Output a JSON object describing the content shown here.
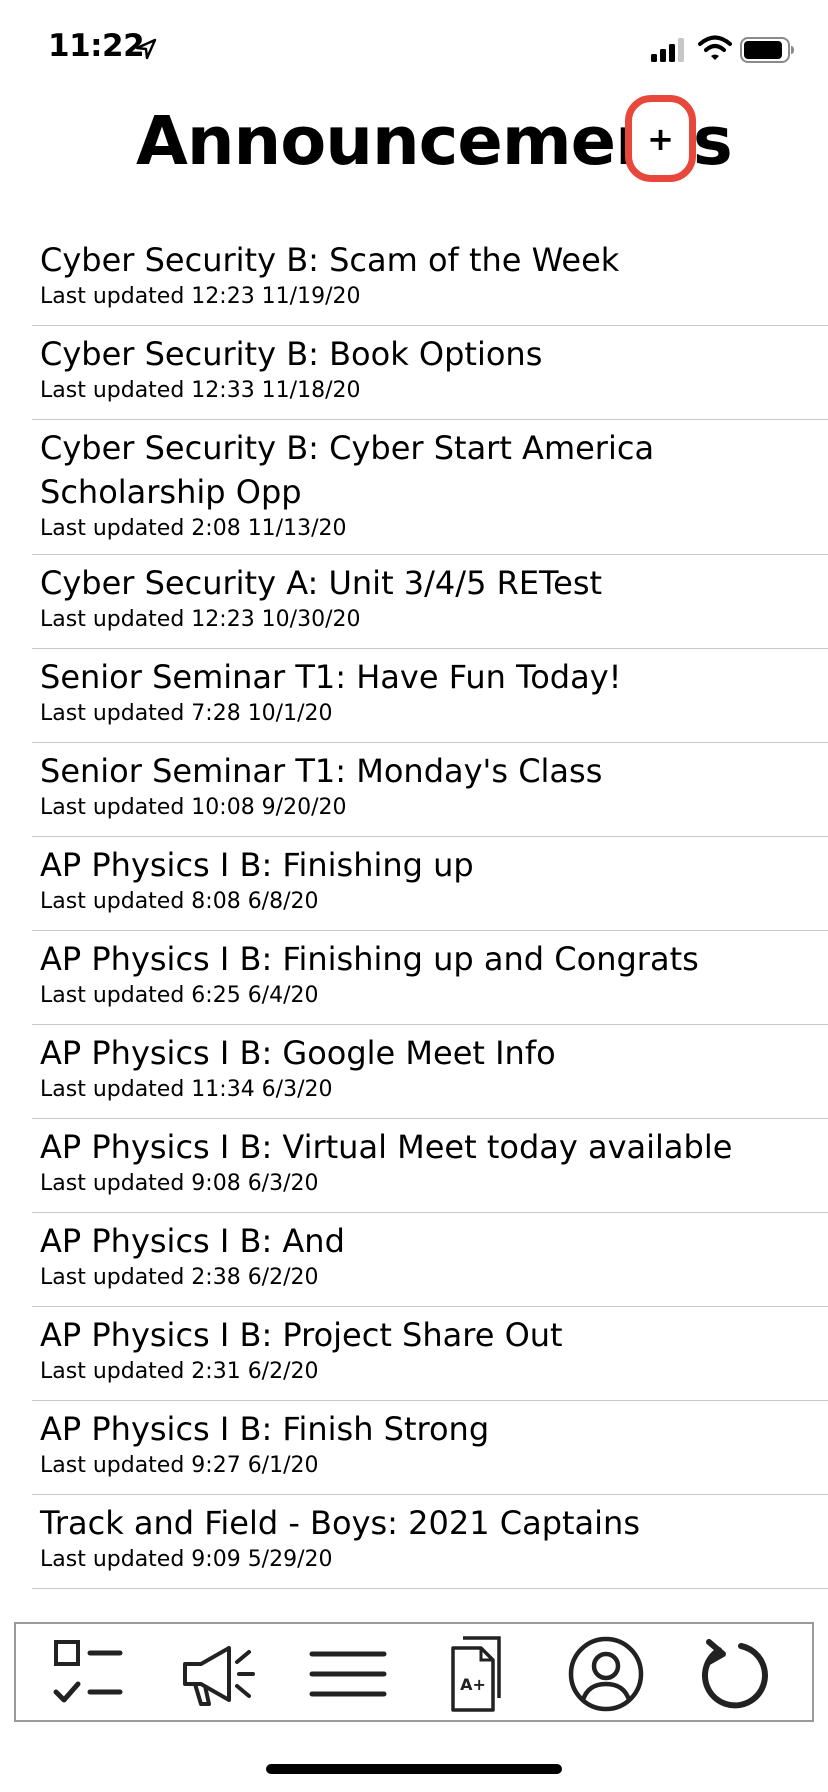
{
  "status_bar": {
    "time": "11:22",
    "icons": [
      "location-arrow-icon",
      "cellular-signal-icon",
      "wifi-icon",
      "battery-icon"
    ]
  },
  "header": {
    "title": "Announcements",
    "add_label": "+",
    "accent_color": "#e8473b"
  },
  "announcements": [
    {
      "title": "Cyber Security B: Scam of the Week",
      "updated": "Last updated 12:23 11/19/20"
    },
    {
      "title": "Cyber Security B: Book Options",
      "updated": "Last updated 12:33 11/18/20"
    },
    {
      "title": "Cyber Security B: Cyber Start America Scholarship Opp",
      "updated": "Last updated 2:08 11/13/20"
    },
    {
      "title": "Cyber Security A: Unit 3/4/5 RETest",
      "updated": "Last updated 12:23 10/30/20"
    },
    {
      "title": "Senior Seminar T1: Have Fun Today!",
      "updated": "Last updated 7:28 10/1/20"
    },
    {
      "title": "Senior Seminar T1: Monday's Class",
      "updated": "Last updated 10:08 9/20/20"
    },
    {
      "title": "AP Physics I B: Finishing up",
      "updated": "Last updated 8:08 6/8/20"
    },
    {
      "title": "AP Physics I B: Finishing up and Congrats",
      "updated": "Last updated 6:25 6/4/20"
    },
    {
      "title": "AP Physics I B: Google Meet Info",
      "updated": "Last updated 11:34 6/3/20"
    },
    {
      "title": "AP Physics I B: Virtual Meet today available",
      "updated": "Last updated 9:08 6/3/20"
    },
    {
      "title": "AP Physics I B: And",
      "updated": "Last updated 2:38 6/2/20"
    },
    {
      "title": "AP Physics I B: Project Share Out",
      "updated": "Last updated 2:31 6/2/20"
    },
    {
      "title": "AP Physics I B: Finish Strong",
      "updated": "Last updated 9:27 6/1/20"
    },
    {
      "title": "Track and Field - Boys: 2021 Captains",
      "updated": "Last updated 9:09 5/29/20"
    }
  ],
  "tab_bar": {
    "tabs": [
      {
        "icon": "checklist-icon"
      },
      {
        "icon": "megaphone-icon"
      },
      {
        "icon": "menu-icon"
      },
      {
        "icon": "grades-document-icon"
      },
      {
        "icon": "profile-icon"
      },
      {
        "icon": "refresh-icon"
      }
    ]
  }
}
